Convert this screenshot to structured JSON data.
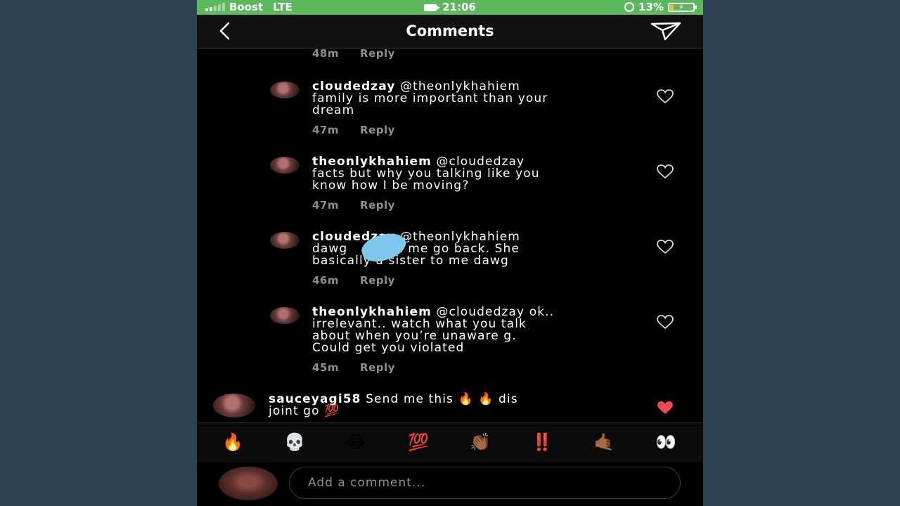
{
  "status_bar": {
    "carrier": "Boost",
    "network": "LTE",
    "time": "21:06",
    "battery": "13%",
    "battery_level": 0.13
  },
  "header": {
    "title": "Comments",
    "back_icon": "chevron-left-icon",
    "send_icon": "paper-plane-icon"
  },
  "comments": {
    "partial_top": {
      "time": "48m",
      "reply": "Reply"
    },
    "items": [
      {
        "username": "cloudedzay",
        "line1": " @theonlykhahiem",
        "line2": "family is more important than your",
        "line3": "dream",
        "line4": "",
        "time": "47m",
        "reply": "Reply"
      },
      {
        "username": "theonlykhahiem",
        "line1": " @cloudedzay",
        "line2": "facts but why you talking like you",
        "line3": "know how I be moving?",
        "line4": "",
        "time": "47m",
        "reply": "Reply"
      },
      {
        "username": "cloudedzay",
        "line1": " @theonlykhahiem",
        "line2": "dawg          & me go back. She",
        "line3": "basically a sister to me dawg",
        "line4": "",
        "time": "46m",
        "reply": "Reply"
      },
      {
        "username": "theonlykhahiem",
        "line1": " @cloudedzay ok..",
        "line2": "irrelevant.. watch what you talk",
        "line3": "about when you’re unaware g.",
        "line4": "Could get you violated",
        "time": "45m",
        "reply": "Reply"
      }
    ],
    "bottom": {
      "username": "sauceyagi58",
      "line1": " Send me this 🔥 🔥  dis",
      "line2": "joint go 💯",
      "liked": true
    }
  },
  "emoji_bar": [
    "🔥",
    "💀",
    "😂",
    "💯",
    "👏🏾",
    "‼️",
    "🤙🏾",
    "👀"
  ],
  "input": {
    "placeholder": "Add a comment..."
  },
  "colors": {
    "status_bar": "#5cb85c",
    "background": "#000000",
    "liked_heart": "#ed4956",
    "muted_text": "#8e8e8e",
    "page_bg": "#2d4353"
  }
}
